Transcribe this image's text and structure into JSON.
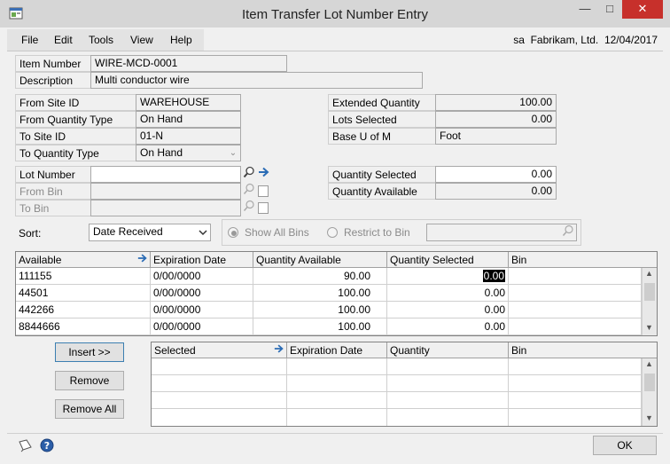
{
  "window": {
    "title": "Item Transfer Lot Number Entry",
    "minimize_glyph": "—",
    "maximize_glyph": "□",
    "close_glyph": "✕",
    "app_icon": "window-app-icon"
  },
  "menu": {
    "items": [
      "File",
      "Edit",
      "Tools",
      "View",
      "Help"
    ],
    "user": "sa",
    "company": "Fabrikam, Ltd.",
    "date": "12/04/2017"
  },
  "item": {
    "item_number_label": "Item Number",
    "item_number": "WIRE-MCD-0001",
    "description_label": "Description",
    "description": "Multi conductor wire"
  },
  "left": {
    "from_site_label": "From Site ID",
    "from_site": "WAREHOUSE",
    "from_qty_type_label": "From Quantity Type",
    "from_qty_type": "On Hand",
    "to_site_label": "To Site ID",
    "to_site": "01-N",
    "to_qty_type_label": "To Quantity Type",
    "to_qty_type": "On Hand"
  },
  "right": {
    "extended_qty_label": "Extended Quantity",
    "extended_qty": "100.00",
    "lots_selected_label": "Lots Selected",
    "lots_selected": "0.00",
    "base_uom_label": "Base U of M",
    "base_uom": "Foot",
    "qty_selected_label": "Quantity Selected",
    "qty_selected": "0.00",
    "qty_available_label": "Quantity Available",
    "qty_available": "0.00"
  },
  "lot": {
    "lot_number_label": "Lot Number",
    "lot_number": "",
    "from_bin_label": "From Bin",
    "to_bin_label": "To Bin"
  },
  "sort": {
    "label": "Sort:",
    "value": "Date Received",
    "show_all_bins": "Show All Bins",
    "restrict_to_bin": "Restrict to Bin"
  },
  "available_grid": {
    "headers": [
      "Available",
      "Expiration Date",
      "Quantity Available",
      "Quantity Selected",
      "Bin"
    ],
    "rows": [
      [
        "111155",
        "0/00/0000",
        "90.00",
        "0.00",
        ""
      ],
      [
        "44501",
        "0/00/0000",
        "100.00",
        "0.00",
        ""
      ],
      [
        "442266",
        "0/00/0000",
        "100.00",
        "0.00",
        ""
      ],
      [
        "8844666",
        "0/00/0000",
        "100.00",
        "0.00",
        ""
      ]
    ]
  },
  "buttons": {
    "insert": "Insert >>",
    "remove": "Remove",
    "remove_all": "Remove All",
    "ok": "OK"
  },
  "selected_grid": {
    "headers": [
      "Selected",
      "Expiration Date",
      "Quantity",
      "Bin"
    ]
  }
}
